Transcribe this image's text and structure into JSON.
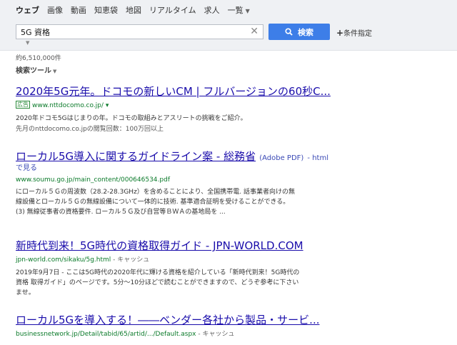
{
  "nav": {
    "items": [
      "ウェブ",
      "画像",
      "動画",
      "知恵袋",
      "地図",
      "リアルタイム",
      "求人",
      "一覧"
    ]
  },
  "search": {
    "query": "5G 資格",
    "button_label": "検索",
    "advanced_label": "条件指定"
  },
  "result_count": "約6,510,000件",
  "search_tools_label": "検索ツール",
  "results": [
    {
      "title": "2020年5G元年。ドコモの新しいCM | フルバージョンの60秒C...",
      "ad_label": "広告",
      "url": "www.nttdocomo.co.jp/",
      "url_caret": "▾",
      "line1": "2020年ドコモ5Gはじまりの年。ドコモの取組みとアスリートの挑戦をご紹介。",
      "line2": "先月のnttdocomo.co.jpの閲覧回数：100万回以上"
    },
    {
      "title": "ローカル5G導入に関するガイドライン案 - 総務省",
      "pdf_tag": "(Adobe PDF)",
      "html_link": "- html",
      "view_link": "で見る",
      "url": "www.soumu.go.jp/main_content/000646534.pdf",
      "snippet1": "にローカル５Ｇの周波数（28.2-28.3GHz）を含めることにより、全国携帯電. 話事業者向けの無",
      "snippet2": "線設備とローカル５Ｇの無線設備について一体的に技術. 基準適合証明を受けることができる。",
      "snippet3": "(3) 無線従事者の資格要件. ローカル５Ｇ及び自営等ＢＷＡの基地局を ..."
    },
    {
      "title": "新時代到来！5G時代の資格取得ガイド - JPN-WORLD.COM",
      "url": "jpn-world.com/sikaku/5g.html",
      "cache": "- キャッシュ",
      "snippet1": "2019年9月7日 - ここは5G時代の2020年代に輝ける資格を紹介している「新時代到来！5G時代の",
      "snippet2": "資格 取得ガイド」のページです。5分～10分ほどで読むことができますので、どうぞ参考に下さい",
      "snippet3": "ませ。"
    },
    {
      "title": "ローカル5Gを導入する！――ベンダー各社から製品・サービ...",
      "url": "businessnetwork.jp/Detail/tabid/65/artid/.../Default.aspx",
      "cache": "- キャッシュ"
    }
  ]
}
